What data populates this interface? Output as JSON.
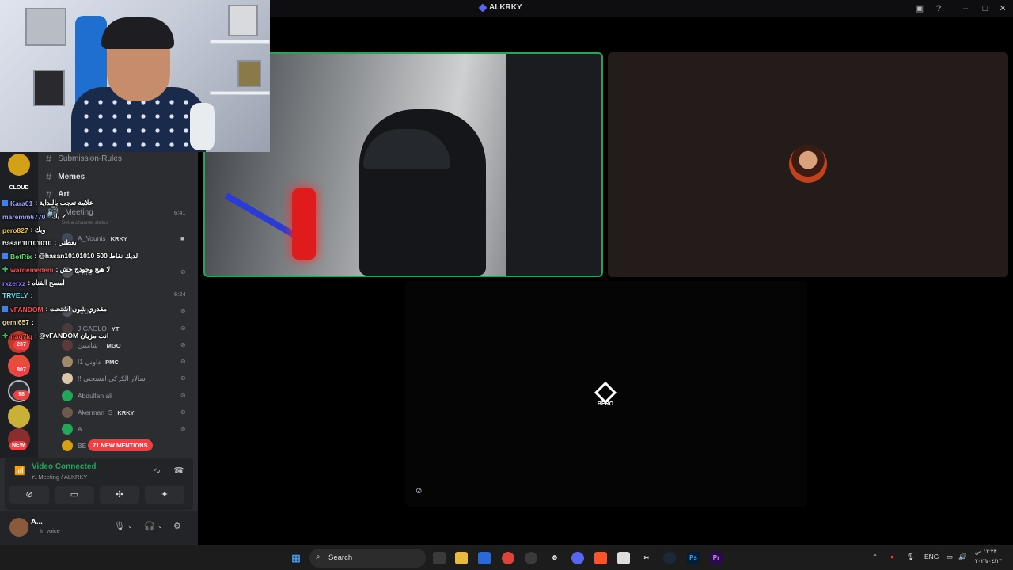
{
  "window": {
    "title": "ALKRKY",
    "controls": [
      "screen-share-icon",
      "help-icon",
      "minimize-icon",
      "maximize-icon",
      "close-icon"
    ]
  },
  "channels": [
    {
      "label": "Submission-Rules",
      "prefix": "ـ ٢"
    },
    {
      "label": "Memes",
      "prefix": "ـ ٢"
    },
    {
      "label": "Art",
      "prefix": "ـ ٢"
    },
    {
      "label": "Meeting",
      "prefix": "ـ ٢"
    }
  ],
  "meeting": {
    "time": "6:41",
    "status_placeholder": "Set a channel status",
    "time2": "6:24"
  },
  "voice_users": [
    {
      "name": "A_Younis",
      "tag": "KRKY"
    },
    {
      "name": "PMC",
      "tag": ""
    },
    {
      "name": "KRKY",
      "tag": ""
    },
    {
      "name": "J GAGLO",
      "tag": "YT"
    },
    {
      "name": "شاميين !",
      "tag": "MGO"
    },
    {
      "name": "!1 داوني",
      "tag": "PMC"
    },
    {
      "name": "!! سالار الكركي امسحني",
      "tag": ""
    },
    {
      "name": "Abdullah ali",
      "tag": ""
    },
    {
      "name": "Akerman_S",
      "tag": "KRKY"
    },
    {
      "name": "A...",
      "tag": ""
    },
    {
      "name": "BE",
      "tag": ""
    }
  ],
  "chat": [
    {
      "user": "Kara01",
      "msg": ": علامة تعجب بالبداية"
    },
    {
      "user": "maremm6770",
      "msg": ": بك ✓"
    },
    {
      "user": "pero827",
      "msg": ": وبك"
    },
    {
      "user": "hasan10101010",
      "msg": ": يعطني"
    },
    {
      "user": "BotRix",
      "msg": ": @hasan10101010 لديك نقاط 500"
    },
    {
      "user": "wardemedeni",
      "msg": ": لا هيج وجودج خش"
    },
    {
      "user": "rxzerxz",
      "msg": ": امسح الفناه"
    },
    {
      "user": "TRVELY",
      "msg": ":"
    },
    {
      "user": "vFANDOM",
      "msg": ": مقدري شون اشتحت"
    },
    {
      "user": "gemi657",
      "msg": ":"
    },
    {
      "user": "iraq7lq",
      "msg": ": @vFANDOM انت مزيان"
    }
  ],
  "servers": [
    {
      "name": "CLOUD",
      "badge": ""
    },
    {
      "name": "server-2",
      "badge": "237"
    },
    {
      "name": "server-3",
      "badge": "807"
    },
    {
      "name": "server-4",
      "badge": "98"
    },
    {
      "name": "server-5",
      "badge": ""
    },
    {
      "name": "server-6",
      "badge": "NEW"
    }
  ],
  "mentions": "71 NEW MENTIONS",
  "voice_panel": {
    "status": "Video Connected",
    "sub": "ـ٢ Meeting / ALKRKY"
  },
  "user": {
    "name": "A...",
    "status": "In voice"
  },
  "stage": {
    "bero_label": "BERO"
  },
  "taskbar": {
    "search": "Search",
    "language": "ENG",
    "time": "١٢:٢٣ ص",
    "date": "٢٠٢٦/٠٤/١٣"
  },
  "colors": {
    "accent": "#5865f2",
    "connected": "#23a55a",
    "danger": "#f23f43",
    "sidebar": "#2b2d31"
  }
}
